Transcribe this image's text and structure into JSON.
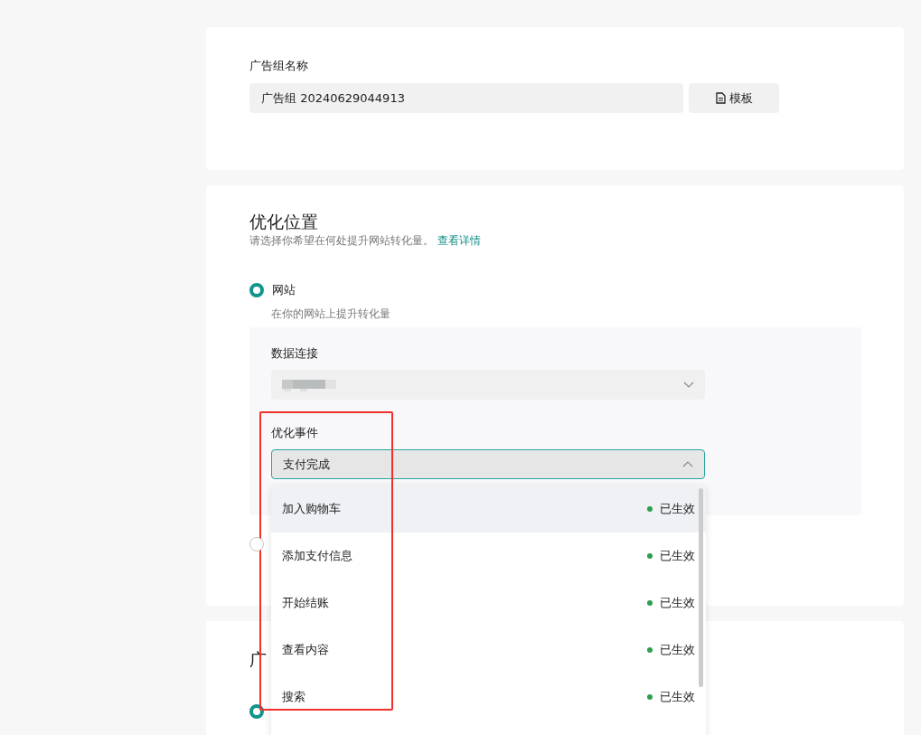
{
  "ad_group": {
    "label": "广告组名称",
    "value": "广告组 20240629044913",
    "template_button": "模板"
  },
  "optimization": {
    "title": "优化位置",
    "subtitle": "请选择你希望在何处提升网站转化量。",
    "link": "查看详情",
    "options": [
      {
        "label": "网站",
        "description": "在你的网站上提升转化量",
        "selected": true
      },
      {
        "selected": false
      }
    ],
    "data_connection": {
      "label": "数据连接"
    },
    "event": {
      "label": "优化事件",
      "value": "支付完成",
      "expanded": true
    },
    "event_options": [
      {
        "label": "加入购物车",
        "status": "已生效",
        "color": "#2e9e4f",
        "highlighted": true
      },
      {
        "label": "添加支付信息",
        "status": "已生效",
        "color": "#2e9e4f",
        "highlighted": false
      },
      {
        "label": "开始结账",
        "status": "已生效",
        "color": "#2e9e4f",
        "highlighted": false
      },
      {
        "label": "查看内容",
        "status": "已生效",
        "color": "#2e9e4f",
        "highlighted": false
      },
      {
        "label": "搜索",
        "status": "已生效",
        "color": "#2e9e4f",
        "highlighted": false
      }
    ]
  },
  "next_section": {
    "title": "广",
    "options": [
      {
        "selected": true
      }
    ]
  }
}
